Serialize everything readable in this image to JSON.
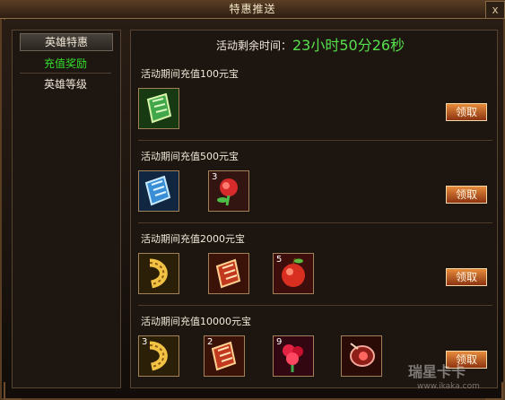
{
  "window": {
    "title": "特惠推送",
    "close_glyph": "x"
  },
  "sidebar": {
    "header": "英雄特惠",
    "items": [
      {
        "label": "充值奖励",
        "active": true
      },
      {
        "label": "英雄等级",
        "active": false
      }
    ]
  },
  "timer": {
    "label": "活动剩余时间：",
    "value": "23小时50分26秒"
  },
  "tiers": [
    {
      "title": "活动期间充值100元宝",
      "claim_label": "领取",
      "items": [
        {
          "icon": "green-scroll-icon",
          "qty": ""
        }
      ]
    },
    {
      "title": "活动期间充值500元宝",
      "claim_label": "领取",
      "items": [
        {
          "icon": "blue-scroll-icon",
          "qty": ""
        },
        {
          "icon": "rose-icon",
          "qty": "3"
        }
      ]
    },
    {
      "title": "活动期间充值2000元宝",
      "claim_label": "领取",
      "items": [
        {
          "icon": "golden-larva-icon",
          "qty": ""
        },
        {
          "icon": "red-scroll-icon",
          "qty": ""
        },
        {
          "icon": "red-apple-icon",
          "qty": "5"
        }
      ]
    },
    {
      "title": "活动期间充值10000元宝",
      "claim_label": "领取",
      "items": [
        {
          "icon": "golden-larva-icon",
          "qty": "3"
        },
        {
          "icon": "red-scroll-icon",
          "qty": "2"
        },
        {
          "icon": "red-rose-bouquet-icon",
          "qty": "9"
        },
        {
          "icon": "red-amulet-icon",
          "qty": ""
        }
      ]
    }
  ],
  "watermark": {
    "logo": "瑞星卡卡",
    "url": "www.ikaka.com"
  },
  "colors": {
    "accent_green": "#57e04c",
    "button_orange": "#e07a32"
  }
}
